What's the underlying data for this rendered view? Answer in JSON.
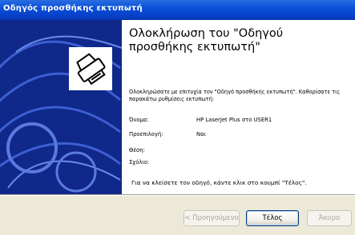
{
  "window": {
    "title": "Οδηγός προσθήκης εκτυπωτή"
  },
  "wizard": {
    "heading": "Ολοκλήρωση του \"Οδηγού προσθήκης εκτυπωτή\"",
    "intro": "Ολοκληρώσατε με επιτυχία τον \"Οδηγό προσθήκης εκτυπωτή\". Καθορίσατε τις παρακάτω ρυθμίσεις εκτυπωτή:",
    "fields": [
      {
        "label": "Όνομα:",
        "value": "HP LaserJet Plus στο USER1"
      },
      {
        "label": "Προεπιλογή:",
        "value": "Ναι"
      },
      {
        "label": "Θέση:",
        "value": ""
      },
      {
        "label": "Σχόλιο:",
        "value": ""
      }
    ],
    "finish_note": "Για να κλείσετε τον οδηγό, κάντε κλικ στο κουμπί \"Τέλος\"."
  },
  "buttons": {
    "back": "< Προηγούμενο",
    "finish": "Τέλος",
    "cancel": "Άκυρο"
  },
  "colors": {
    "sidebar": "#10288a",
    "titlebar": "#0a4fd8",
    "dialog_background": "#ece9d8"
  },
  "icons": {
    "sidebar_icon": "printer-icon"
  }
}
